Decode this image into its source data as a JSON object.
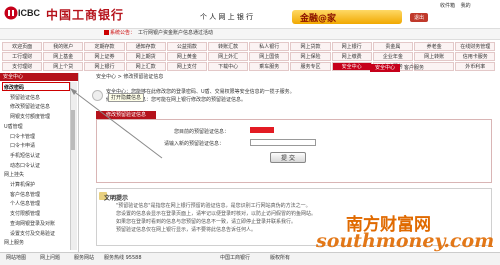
{
  "header": {
    "brand_en": "ICBC",
    "brand_cn": "中国工商银行",
    "online_bank": "个 人 网 上 银 行",
    "gold_home": "金融@家",
    "logout": "退出",
    "top_links": [
      "收件箱",
      "我的"
    ]
  },
  "news": {
    "label": "系统公告：",
    "text": "工行网银户资金账户信息通过活动"
  },
  "nav": {
    "row1": [
      "欢迎页面",
      "我的账户",
      "定期存款",
      "通知存款",
      "公益捐款",
      "转账汇款",
      "私人银行",
      "网上贷款",
      "网上银行",
      "贵金属",
      "养老金",
      "在线财务管理"
    ],
    "row2": [
      "工行理财",
      "网上基金",
      "网上证券",
      "网上期货",
      "网上黄金",
      "网上外汇",
      "网上国债",
      "网上保险",
      "网上缴费",
      "企业年金",
      "网上转账",
      "信用卡服务"
    ],
    "row3": [
      "支付理财",
      "网上个贷",
      "网上银行",
      "网上汇款",
      "网上支付",
      "下载中心",
      "乘车服务",
      "服务专区",
      "安全中心",
      "客户服务",
      "",
      "外币利率"
    ]
  },
  "tabs": {
    "current": "安全中心",
    "online_service": "客户服务"
  },
  "breadcrumb": "安全中心 > 修改预留验证信息",
  "sidebar": {
    "head": "安全中心",
    "items": [
      {
        "label": "修改密码",
        "sub": false
      },
      {
        "label": "预留验证信息",
        "sub": true
      },
      {
        "label": "修改预留验证信息",
        "sub": true
      },
      {
        "label": "网银支付额度管理",
        "sub": true
      },
      {
        "label": "U盾管理",
        "sub": false
      },
      {
        "label": "口令卡管理",
        "sub": true
      },
      {
        "label": "口令卡申请",
        "sub": true
      },
      {
        "label": "手机短信认证",
        "sub": true
      },
      {
        "label": "动态口令认证",
        "sub": true
      },
      {
        "label": "网上挂失",
        "sub": false
      },
      {
        "label": "计算机保护",
        "sub": true
      },
      {
        "label": "客户信息管理",
        "sub": true
      },
      {
        "label": "个人信息管理",
        "sub": true
      },
      {
        "label": "支付限额管理",
        "sub": true
      },
      {
        "label": "查询网银登录及对账",
        "sub": true
      },
      {
        "label": "设置支付及交易验证",
        "sub": true
      },
      {
        "label": "网上服务",
        "sub": false
      }
    ]
  },
  "info": {
    "line1": "安全中心：您能够在此修改您的登录密码、U盾、交易权限等安全信息的一揽子服务。",
    "line2": "修改预留验证信息：您可能在网上银行修改您的预留验证信息。",
    "tooltip": "打开隐藏信息"
  },
  "form": {
    "tab": "修改预留验证信息",
    "label1": "您目前的预留验证信息：",
    "label2": "请输入新的预留验证信息：",
    "submit": "提 交"
  },
  "tips": {
    "title": "文明提示",
    "lines": [
      "\"预留验证信息\"是指您在网上银行预留的验证信息，是您识别工行网站真伪的方法之一。",
      "您设置的信息会显示在登录页面上，请牢记以便登录时核对，以防止访问假冒的钓鱼网站。",
      "如果您在登录时看到的信息与您预留的信息不一致，请立即停止登录并联系我行。",
      "预留验证信息仅在网上银行显示，请不要将此信息告诉任何人。"
    ]
  },
  "footer": {
    "items": [
      "网站地图",
      "网上问题",
      "服务网站",
      "服务热线 95588",
      "中国工商银行",
      "版权所有"
    ]
  },
  "watermark": {
    "logo": "南方财富网",
    "url": "southmoney.com"
  }
}
